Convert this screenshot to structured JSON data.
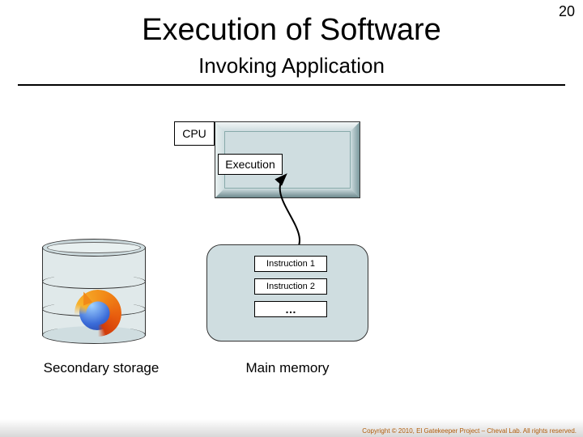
{
  "page_number": "20",
  "title": "Execution of Software",
  "subtitle": "Invoking Application",
  "cpu": {
    "label": "CPU",
    "execution_label": "Execution"
  },
  "main_memory": {
    "instructions": [
      "Instruction 1",
      "Instruction 2",
      "…"
    ],
    "label": "Main memory"
  },
  "secondary_storage": {
    "label": "Secondary storage",
    "app_icon": "firefox-icon"
  },
  "copyright": "Copyright © 2010, El Gatekeeper Project – Cheval Lab. All rights reserved."
}
